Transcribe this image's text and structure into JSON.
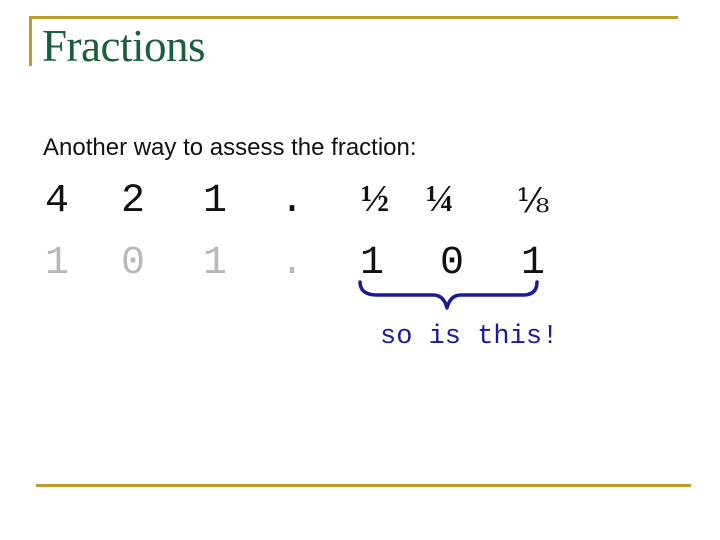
{
  "slide": {
    "title": "Fractions",
    "subtitle": "Another way to assess the fraction:",
    "accent_color": "#c09a2a",
    "title_color": "#1b5e3b",
    "place_values": [
      "4",
      "2",
      "1",
      ".",
      "½",
      "¼",
      "⅛"
    ],
    "binary_digits": [
      "1",
      "0",
      "1",
      ".",
      "1",
      "0",
      "1"
    ],
    "brace_label": "so is this!",
    "brace_color": "#1a1a9c",
    "brace_icon": "curly-brace-under"
  }
}
